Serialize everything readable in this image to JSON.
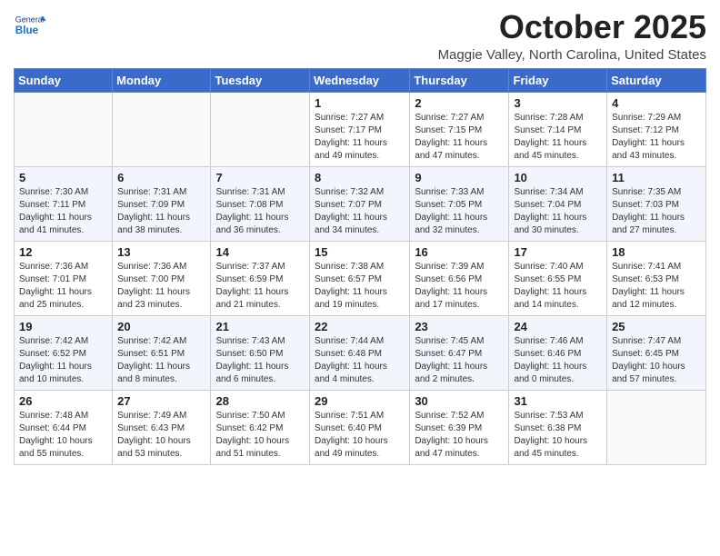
{
  "logo": {
    "general": "General",
    "blue": "Blue"
  },
  "title": {
    "month": "October 2025",
    "location": "Maggie Valley, North Carolina, United States"
  },
  "weekdays": [
    "Sunday",
    "Monday",
    "Tuesday",
    "Wednesday",
    "Thursday",
    "Friday",
    "Saturday"
  ],
  "weeks": [
    [
      {
        "day": "",
        "sunrise": "",
        "sunset": "",
        "daylight": ""
      },
      {
        "day": "",
        "sunrise": "",
        "sunset": "",
        "daylight": ""
      },
      {
        "day": "",
        "sunrise": "",
        "sunset": "",
        "daylight": ""
      },
      {
        "day": "1",
        "sunrise": "Sunrise: 7:27 AM",
        "sunset": "Sunset: 7:17 PM",
        "daylight": "Daylight: 11 hours and 49 minutes."
      },
      {
        "day": "2",
        "sunrise": "Sunrise: 7:27 AM",
        "sunset": "Sunset: 7:15 PM",
        "daylight": "Daylight: 11 hours and 47 minutes."
      },
      {
        "day": "3",
        "sunrise": "Sunrise: 7:28 AM",
        "sunset": "Sunset: 7:14 PM",
        "daylight": "Daylight: 11 hours and 45 minutes."
      },
      {
        "day": "4",
        "sunrise": "Sunrise: 7:29 AM",
        "sunset": "Sunset: 7:12 PM",
        "daylight": "Daylight: 11 hours and 43 minutes."
      }
    ],
    [
      {
        "day": "5",
        "sunrise": "Sunrise: 7:30 AM",
        "sunset": "Sunset: 7:11 PM",
        "daylight": "Daylight: 11 hours and 41 minutes."
      },
      {
        "day": "6",
        "sunrise": "Sunrise: 7:31 AM",
        "sunset": "Sunset: 7:09 PM",
        "daylight": "Daylight: 11 hours and 38 minutes."
      },
      {
        "day": "7",
        "sunrise": "Sunrise: 7:31 AM",
        "sunset": "Sunset: 7:08 PM",
        "daylight": "Daylight: 11 hours and 36 minutes."
      },
      {
        "day": "8",
        "sunrise": "Sunrise: 7:32 AM",
        "sunset": "Sunset: 7:07 PM",
        "daylight": "Daylight: 11 hours and 34 minutes."
      },
      {
        "day": "9",
        "sunrise": "Sunrise: 7:33 AM",
        "sunset": "Sunset: 7:05 PM",
        "daylight": "Daylight: 11 hours and 32 minutes."
      },
      {
        "day": "10",
        "sunrise": "Sunrise: 7:34 AM",
        "sunset": "Sunset: 7:04 PM",
        "daylight": "Daylight: 11 hours and 30 minutes."
      },
      {
        "day": "11",
        "sunrise": "Sunrise: 7:35 AM",
        "sunset": "Sunset: 7:03 PM",
        "daylight": "Daylight: 11 hours and 27 minutes."
      }
    ],
    [
      {
        "day": "12",
        "sunrise": "Sunrise: 7:36 AM",
        "sunset": "Sunset: 7:01 PM",
        "daylight": "Daylight: 11 hours and 25 minutes."
      },
      {
        "day": "13",
        "sunrise": "Sunrise: 7:36 AM",
        "sunset": "Sunset: 7:00 PM",
        "daylight": "Daylight: 11 hours and 23 minutes."
      },
      {
        "day": "14",
        "sunrise": "Sunrise: 7:37 AM",
        "sunset": "Sunset: 6:59 PM",
        "daylight": "Daylight: 11 hours and 21 minutes."
      },
      {
        "day": "15",
        "sunrise": "Sunrise: 7:38 AM",
        "sunset": "Sunset: 6:57 PM",
        "daylight": "Daylight: 11 hours and 19 minutes."
      },
      {
        "day": "16",
        "sunrise": "Sunrise: 7:39 AM",
        "sunset": "Sunset: 6:56 PM",
        "daylight": "Daylight: 11 hours and 17 minutes."
      },
      {
        "day": "17",
        "sunrise": "Sunrise: 7:40 AM",
        "sunset": "Sunset: 6:55 PM",
        "daylight": "Daylight: 11 hours and 14 minutes."
      },
      {
        "day": "18",
        "sunrise": "Sunrise: 7:41 AM",
        "sunset": "Sunset: 6:53 PM",
        "daylight": "Daylight: 11 hours and 12 minutes."
      }
    ],
    [
      {
        "day": "19",
        "sunrise": "Sunrise: 7:42 AM",
        "sunset": "Sunset: 6:52 PM",
        "daylight": "Daylight: 11 hours and 10 minutes."
      },
      {
        "day": "20",
        "sunrise": "Sunrise: 7:42 AM",
        "sunset": "Sunset: 6:51 PM",
        "daylight": "Daylight: 11 hours and 8 minutes."
      },
      {
        "day": "21",
        "sunrise": "Sunrise: 7:43 AM",
        "sunset": "Sunset: 6:50 PM",
        "daylight": "Daylight: 11 hours and 6 minutes."
      },
      {
        "day": "22",
        "sunrise": "Sunrise: 7:44 AM",
        "sunset": "Sunset: 6:48 PM",
        "daylight": "Daylight: 11 hours and 4 minutes."
      },
      {
        "day": "23",
        "sunrise": "Sunrise: 7:45 AM",
        "sunset": "Sunset: 6:47 PM",
        "daylight": "Daylight: 11 hours and 2 minutes."
      },
      {
        "day": "24",
        "sunrise": "Sunrise: 7:46 AM",
        "sunset": "Sunset: 6:46 PM",
        "daylight": "Daylight: 11 hours and 0 minutes."
      },
      {
        "day": "25",
        "sunrise": "Sunrise: 7:47 AM",
        "sunset": "Sunset: 6:45 PM",
        "daylight": "Daylight: 10 hours and 57 minutes."
      }
    ],
    [
      {
        "day": "26",
        "sunrise": "Sunrise: 7:48 AM",
        "sunset": "Sunset: 6:44 PM",
        "daylight": "Daylight: 10 hours and 55 minutes."
      },
      {
        "day": "27",
        "sunrise": "Sunrise: 7:49 AM",
        "sunset": "Sunset: 6:43 PM",
        "daylight": "Daylight: 10 hours and 53 minutes."
      },
      {
        "day": "28",
        "sunrise": "Sunrise: 7:50 AM",
        "sunset": "Sunset: 6:42 PM",
        "daylight": "Daylight: 10 hours and 51 minutes."
      },
      {
        "day": "29",
        "sunrise": "Sunrise: 7:51 AM",
        "sunset": "Sunset: 6:40 PM",
        "daylight": "Daylight: 10 hours and 49 minutes."
      },
      {
        "day": "30",
        "sunrise": "Sunrise: 7:52 AM",
        "sunset": "Sunset: 6:39 PM",
        "daylight": "Daylight: 10 hours and 47 minutes."
      },
      {
        "day": "31",
        "sunrise": "Sunrise: 7:53 AM",
        "sunset": "Sunset: 6:38 PM",
        "daylight": "Daylight: 10 hours and 45 minutes."
      },
      {
        "day": "",
        "sunrise": "",
        "sunset": "",
        "daylight": ""
      }
    ]
  ]
}
